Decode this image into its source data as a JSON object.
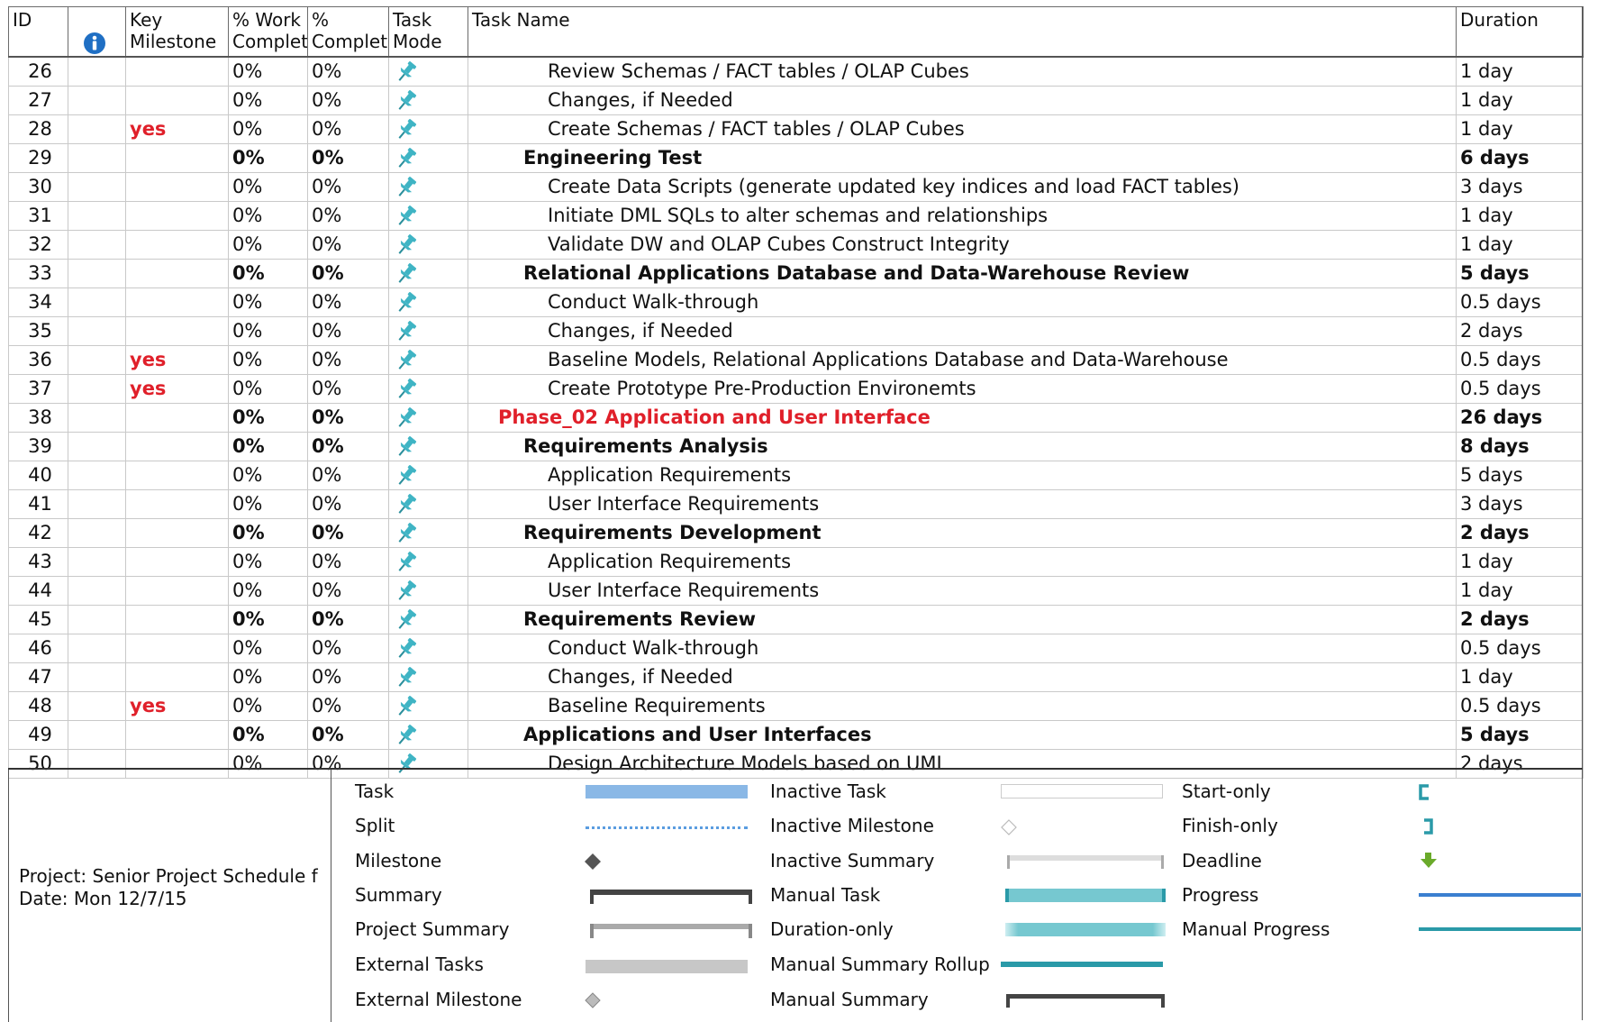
{
  "columns": {
    "id": "ID",
    "key_milestone": "Key Milestone",
    "work_complete": "% Work Complet",
    "complete": "% Complet",
    "task_mode": "Task Mode",
    "task_name": "Task Name",
    "duration": "Duration"
  },
  "info_icon": "info-icon",
  "pin_color": "#3fb4c4",
  "rows": [
    {
      "id": "26",
      "key": "",
      "work": "0%",
      "comp": "0%",
      "name": "Review Schemas / FACT tables / OLAP Cubes",
      "dur": "1 day",
      "level": 2,
      "bold": false,
      "phase": false
    },
    {
      "id": "27",
      "key": "",
      "work": "0%",
      "comp": "0%",
      "name": "Changes, if Needed",
      "dur": "1 day",
      "level": 2,
      "bold": false,
      "phase": false
    },
    {
      "id": "28",
      "key": "yes",
      "work": "0%",
      "comp": "0%",
      "name": "Create Schemas / FACT tables / OLAP Cubes",
      "dur": "1 day",
      "level": 2,
      "bold": false,
      "phase": false
    },
    {
      "id": "29",
      "key": "",
      "work": "0%",
      "comp": "0%",
      "name": "Engineering Test",
      "dur": "6 days",
      "level": 1,
      "bold": true,
      "phase": false
    },
    {
      "id": "30",
      "key": "",
      "work": "0%",
      "comp": "0%",
      "name": "Create Data Scripts (generate updated key indices and load FACT tables)",
      "dur": "3 days",
      "level": 2,
      "bold": false,
      "phase": false
    },
    {
      "id": "31",
      "key": "",
      "work": "0%",
      "comp": "0%",
      "name": "Initiate DML SQLs to alter schemas and relationships",
      "dur": "1 day",
      "level": 2,
      "bold": false,
      "phase": false
    },
    {
      "id": "32",
      "key": "",
      "work": "0%",
      "comp": "0%",
      "name": "Validate DW and OLAP Cubes Construct Integrity",
      "dur": "1 day",
      "level": 2,
      "bold": false,
      "phase": false
    },
    {
      "id": "33",
      "key": "",
      "work": "0%",
      "comp": "0%",
      "name": "Relational Applications Database and Data-Warehouse Review",
      "dur": "5 days",
      "level": 1,
      "bold": true,
      "phase": false
    },
    {
      "id": "34",
      "key": "",
      "work": "0%",
      "comp": "0%",
      "name": "Conduct Walk-through",
      "dur": "0.5 days",
      "level": 2,
      "bold": false,
      "phase": false
    },
    {
      "id": "35",
      "key": "",
      "work": "0%",
      "comp": "0%",
      "name": "Changes, if Needed",
      "dur": "2 days",
      "level": 2,
      "bold": false,
      "phase": false
    },
    {
      "id": "36",
      "key": "yes",
      "work": "0%",
      "comp": "0%",
      "name": "Baseline Models, Relational Applications Database and Data-Warehouse",
      "dur": "0.5 days",
      "level": 2,
      "bold": false,
      "phase": false
    },
    {
      "id": "37",
      "key": "yes",
      "work": "0%",
      "comp": "0%",
      "name": "Create Prototype Pre-Production Environemts",
      "dur": "0.5 days",
      "level": 2,
      "bold": false,
      "phase": false
    },
    {
      "id": "38",
      "key": "",
      "work": "0%",
      "comp": "0%",
      "name": "Phase_02   Application and User Interface",
      "dur": "26 days",
      "level": 0,
      "bold": true,
      "phase": true
    },
    {
      "id": "39",
      "key": "",
      "work": "0%",
      "comp": "0%",
      "name": "Requirements Analysis",
      "dur": "8 days",
      "level": 1,
      "bold": true,
      "phase": false
    },
    {
      "id": "40",
      "key": "",
      "work": "0%",
      "comp": "0%",
      "name": "Application Requirements",
      "dur": "5 days",
      "level": 2,
      "bold": false,
      "phase": false
    },
    {
      "id": "41",
      "key": "",
      "work": "0%",
      "comp": "0%",
      "name": "User Interface Requirements",
      "dur": "3 days",
      "level": 2,
      "bold": false,
      "phase": false
    },
    {
      "id": "42",
      "key": "",
      "work": "0%",
      "comp": "0%",
      "name": "Requirements Development",
      "dur": "2 days",
      "level": 1,
      "bold": true,
      "phase": false
    },
    {
      "id": "43",
      "key": "",
      "work": "0%",
      "comp": "0%",
      "name": "Application Requirements",
      "dur": "1 day",
      "level": 2,
      "bold": false,
      "phase": false
    },
    {
      "id": "44",
      "key": "",
      "work": "0%",
      "comp": "0%",
      "name": "User Interface Requirements",
      "dur": "1 day",
      "level": 2,
      "bold": false,
      "phase": false
    },
    {
      "id": "45",
      "key": "",
      "work": "0%",
      "comp": "0%",
      "name": "Requirements Review",
      "dur": "2 days",
      "level": 1,
      "bold": true,
      "phase": false
    },
    {
      "id": "46",
      "key": "",
      "work": "0%",
      "comp": "0%",
      "name": "Conduct Walk-through",
      "dur": "0.5 days",
      "level": 2,
      "bold": false,
      "phase": false
    },
    {
      "id": "47",
      "key": "",
      "work": "0%",
      "comp": "0%",
      "name": "Changes, if Needed",
      "dur": "1 day",
      "level": 2,
      "bold": false,
      "phase": false
    },
    {
      "id": "48",
      "key": "yes",
      "work": "0%",
      "comp": "0%",
      "name": "Baseline Requirements",
      "dur": "0.5 days",
      "level": 2,
      "bold": false,
      "phase": false
    },
    {
      "id": "49",
      "key": "",
      "work": "0%",
      "comp": "0%",
      "name": "Applications and User Interfaces",
      "dur": "5 days",
      "level": 1,
      "bold": true,
      "phase": false
    },
    {
      "id": "50",
      "key": "",
      "work": "0%",
      "comp": "0%",
      "name": "Design Architecture Models based on UML",
      "dur": "2 days",
      "level": 2,
      "bold": false,
      "phase": false
    }
  ],
  "project": {
    "project_line": "Project: Senior Project Schedule f",
    "date_line": "Date: Mon 12/7/15"
  },
  "legend": {
    "col1": [
      "Task",
      "Split",
      "Milestone",
      "Summary",
      "Project Summary",
      "External Tasks",
      "External Milestone"
    ],
    "col2": [
      "Inactive Task",
      "Inactive Milestone",
      "Inactive Summary",
      "Manual Task",
      "Duration-only",
      "Manual Summary Rollup",
      "Manual Summary"
    ],
    "col3": [
      "Start-only",
      "Finish-only",
      "Deadline",
      "Progress",
      "Manual Progress"
    ]
  },
  "colors": {
    "task_bar": "#8ab8e6",
    "manual_teal": "#3fb4c4",
    "red": "#e0202a",
    "deadline_green": "#6aaa2a",
    "progress_blue": "#3a7fd0"
  }
}
